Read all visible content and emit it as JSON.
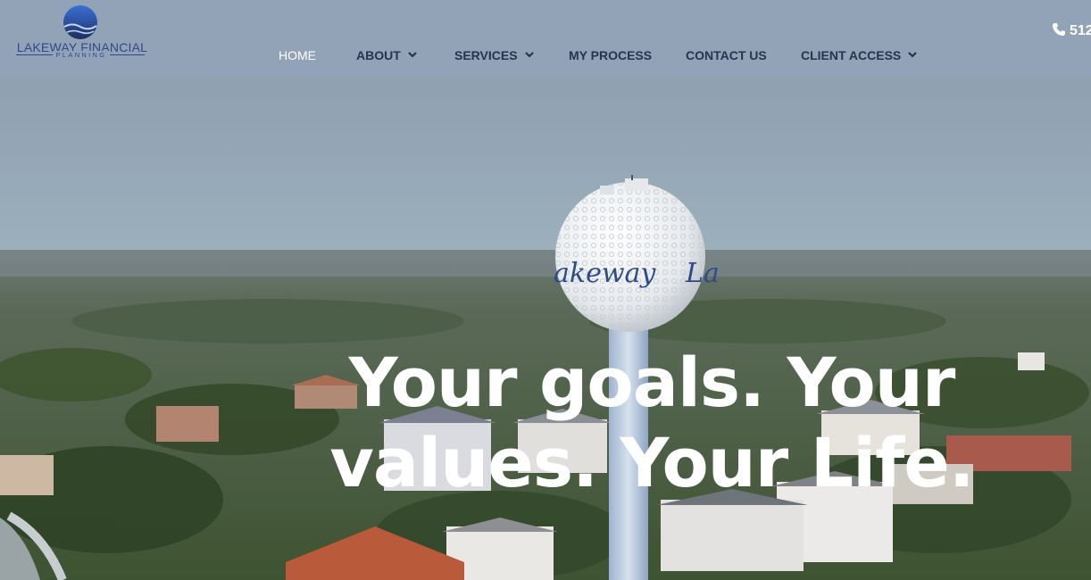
{
  "brand": {
    "name": "LAKEWAY FINANCIAL",
    "sub": "PLANNING",
    "primary_color": "#2e4a8c",
    "logo_icon": "sun-over-water-logo-icon"
  },
  "header": {
    "background": "#92a2b8",
    "phone_icon": "phone-icon",
    "phone_visible": "512"
  },
  "nav": {
    "items": [
      {
        "label": "HOME",
        "active": true,
        "dropdown": false
      },
      {
        "label": "ABOUT",
        "active": false,
        "dropdown": true
      },
      {
        "label": "SERVICES",
        "active": false,
        "dropdown": true
      },
      {
        "label": "MY PROCESS",
        "active": false,
        "dropdown": false
      },
      {
        "label": "CONTACT US",
        "active": false,
        "dropdown": false
      },
      {
        "label": "CLIENT ACCESS",
        "active": false,
        "dropdown": true
      }
    ]
  },
  "hero": {
    "line1": "Your goals. Your",
    "line2": "values. Your Life.",
    "tower_text_left": "akeway",
    "tower_text_right": "La",
    "image_description_icon": "aerial-water-tower-background"
  }
}
